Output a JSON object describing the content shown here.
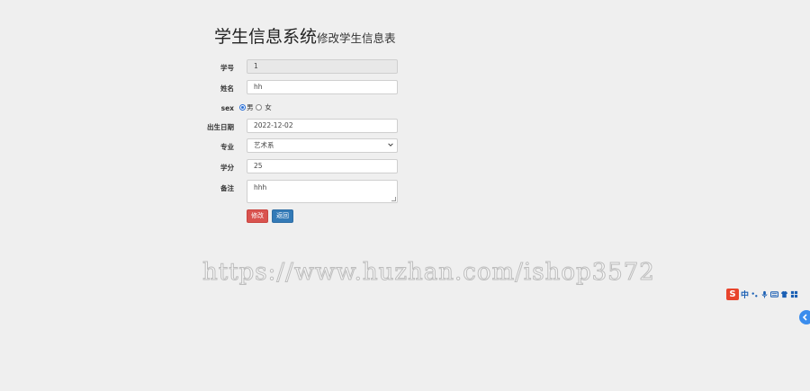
{
  "header": {
    "title": "学生信息系统",
    "subtitle": "修改学生信息表"
  },
  "form": {
    "student_id": {
      "label": "学号",
      "value": "1"
    },
    "name": {
      "label": "姓名",
      "value": "hh"
    },
    "sex": {
      "label": "sex",
      "options": [
        "男",
        "女"
      ],
      "selected": "男"
    },
    "birth_date": {
      "label": "出生日期",
      "value": "2022-12-02"
    },
    "major": {
      "label": "专业",
      "selected": "艺术系"
    },
    "credits": {
      "label": "学分",
      "value": "25"
    },
    "remarks": {
      "label": "备注",
      "value": "hhh"
    }
  },
  "buttons": {
    "submit_label": "修改",
    "back_label": "返回"
  },
  "watermark": "https://www.huzhan.com/ishop3572",
  "ime_toolbar": {
    "logo": "S",
    "mode": "中",
    "icons": [
      "punctuation-icon",
      "microphone-icon",
      "keyboard-icon",
      "skin-icon",
      "toolbox-icon"
    ]
  },
  "colors": {
    "submit_button": "#d9534f",
    "back_button": "#337ab7",
    "ime_logo": "#e8442c",
    "side_tab": "#3b8ded"
  }
}
